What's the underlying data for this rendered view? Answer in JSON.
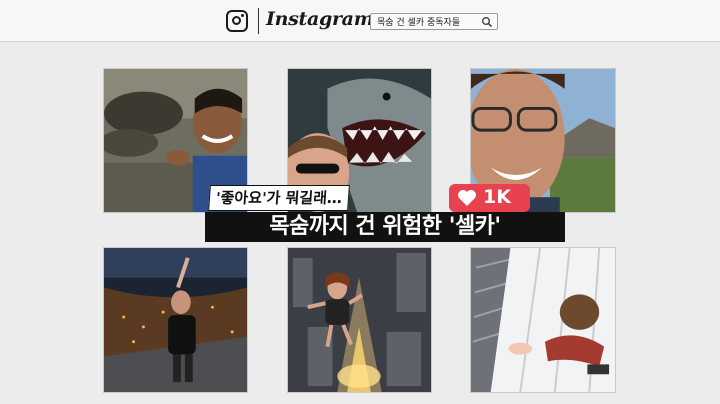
{
  "header": {
    "brand": "Instagram",
    "search_value": "목숨 건 셀카 중독자들",
    "icons": {
      "logo": "instagram-camera-icon",
      "search": "magnifier-icon"
    }
  },
  "caption": {
    "tag": "'좋아요'가 뭐길래…",
    "headline": "목숨까지 건 위험한 '셀카'"
  },
  "like_badge": {
    "icon": "heart-icon",
    "count": "1K",
    "color": "#e8414f"
  },
  "photos": [
    {
      "subject": "smiling man at shore"
    },
    {
      "subject": "man with shark"
    },
    {
      "subject": "smiling man outdoors"
    },
    {
      "subject": "rooftop selfie over city at night"
    },
    {
      "subject": "woman on skyscraper spire"
    },
    {
      "subject": "climber hanging off building"
    }
  ]
}
